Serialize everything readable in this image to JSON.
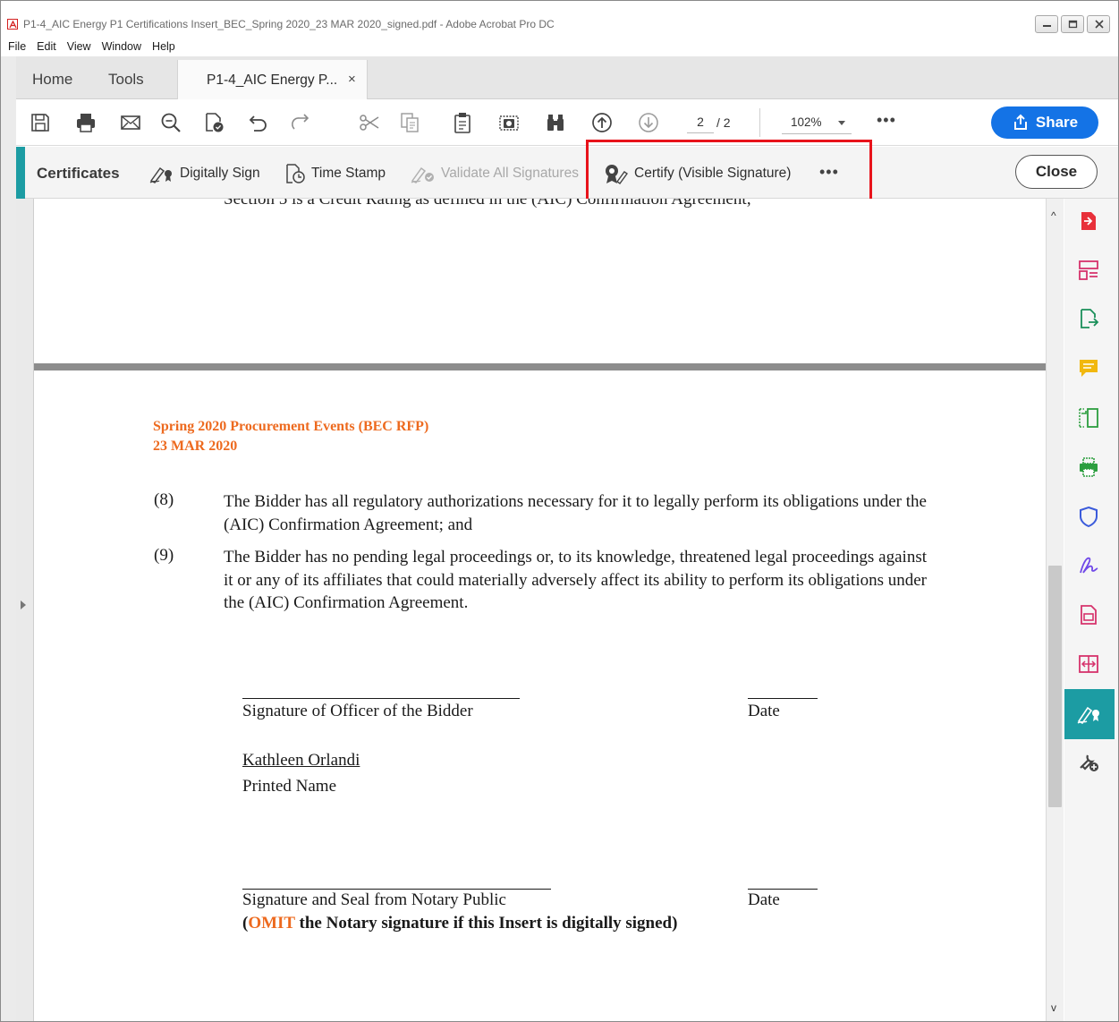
{
  "window": {
    "title": "P1-4_AIC Energy P1 Certifications Insert_BEC_Spring 2020_23 MAR 2020_signed.pdf - Adobe Acrobat Pro DC"
  },
  "menu": [
    "File",
    "Edit",
    "View",
    "Window",
    "Help"
  ],
  "tabs": {
    "home": "Home",
    "tools": "Tools",
    "document": "P1-4_AIC Energy P...",
    "close_glyph": "×"
  },
  "toolbar": {
    "icons": [
      "save-icon",
      "print-icon",
      "email-icon",
      "zoom-search-icon",
      "edit-pdf-icon",
      "undo-icon",
      "redo-icon",
      "cut-icon",
      "copy-icon",
      "paste-icon",
      "snapshot-icon",
      "find-binoculars-icon",
      "page-up-icon",
      "page-down-icon"
    ],
    "current_page": "2",
    "total_pages": "/ 2",
    "zoom": "102%",
    "more": "•••",
    "share_label": "Share"
  },
  "certificates_bar": {
    "title": "Certificates",
    "digitally_sign": "Digitally Sign",
    "time_stamp": "Time Stamp",
    "validate_all": "Validate All Signatures",
    "certify_visible": "Certify (Visible Signature)",
    "more": "•••",
    "close_label": "Close",
    "highlight_color": "#e8131b",
    "accent_color": "#1c9ca3"
  },
  "document": {
    "cut_off_line": "Section 5 is a Credit Rating as defined in the (AIC) Confirmation Agreement;",
    "header_line1": "Spring 2020 Procurement Events (BEC RFP)",
    "header_line2": "23 MAR 2020",
    "items": [
      {
        "num": "(8)",
        "text": "The Bidder has all regulatory authorizations necessary for it to legally perform its obligations under the (AIC) Confirmation Agreement; and"
      },
      {
        "num": "(9)",
        "text": "The Bidder has no pending legal proceedings or, to its knowledge, threatened legal proceedings against it or any of its affiliates that could materially adversely affect its ability to perform its obligations under the (AIC) Confirmation Agreement."
      }
    ],
    "sig_officer_label": "Signature of Officer of the Bidder",
    "date_label": "Date",
    "printed_name_value": "Kathleen Orlandi",
    "printed_name_label": "Printed Name",
    "sig_notary_label": "Signature and Seal from Notary Public",
    "date_label_2": "Date",
    "omit_open": "(",
    "omit_word": "OMIT",
    "omit_rest": " the Notary signature if this Insert is digitally signed",
    "omit_close": ")",
    "accent_color": "#ed6a1f"
  },
  "right_rail": {
    "icons": [
      "export-pdf-icon",
      "organize-pages-icon",
      "export-file-icon",
      "comment-icon",
      "compress-icon",
      "print-production-icon",
      "protect-icon",
      "fill-sign-icon",
      "create-pdf-icon",
      "compare-icon",
      "certificates-icon",
      "more-tools-icon"
    ]
  }
}
